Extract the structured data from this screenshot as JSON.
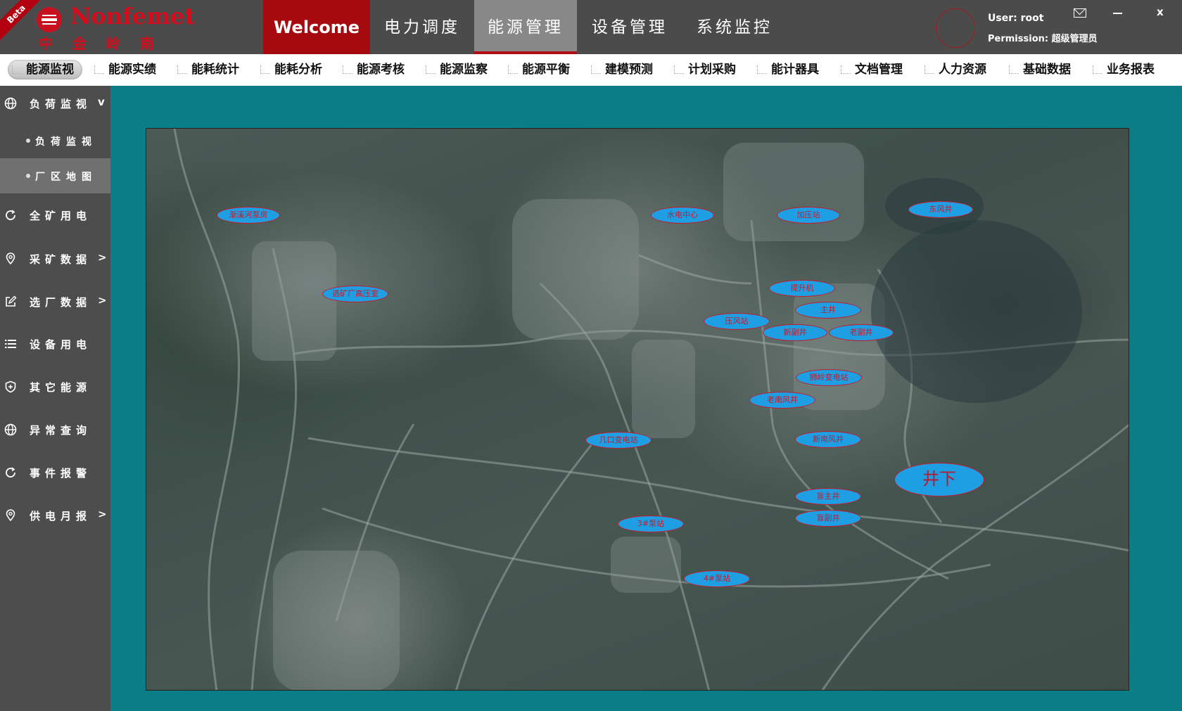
{
  "header": {
    "beta": "Beta",
    "logo_text": "Nonfemet",
    "logo_cn": "中金岭南",
    "nav": [
      "Welcome",
      "电力调度",
      "能源管理",
      "设备管理",
      "系统监控"
    ],
    "active_nav": "能源管理",
    "user_label": "User:",
    "user_value": "root",
    "permission_label": "Permission:",
    "permission_value": "超级管理员",
    "close_symbol": "x"
  },
  "toolbar": {
    "items": [
      "能源监视",
      "能源实绩",
      "能耗统计",
      "能耗分析",
      "能源考核",
      "能源监察",
      "能源平衡",
      "建模预测",
      "计划采购",
      "能计器具",
      "文档管理",
      "人力资源",
      "基础数据",
      "业务报表"
    ],
    "active": "能源监视"
  },
  "sidebar": {
    "items": [
      {
        "label": "负荷监视",
        "icon": "globe-icon",
        "chevron": "v"
      },
      {
        "label": "负荷监视",
        "sub": true
      },
      {
        "label": "厂区地图",
        "sub": true,
        "active": true
      },
      {
        "label": "全矿用电",
        "icon": "refresh-icon"
      },
      {
        "label": "采矿数据",
        "icon": "location-icon",
        "chevron": ">"
      },
      {
        "label": "选厂数据",
        "icon": "edit-icon",
        "chevron": ">"
      },
      {
        "label": "设备用电",
        "icon": "list-icon"
      },
      {
        "label": "其它能源",
        "icon": "shield-icon"
      },
      {
        "label": "异常查询",
        "icon": "globe-icon"
      },
      {
        "label": "事件报警",
        "icon": "refresh-icon"
      },
      {
        "label": "供电月报",
        "icon": "location-icon",
        "chevron": ">"
      }
    ]
  },
  "map": {
    "markers": [
      "渐溪河泵房",
      "水电中心",
      "加压站",
      "东风井",
      "选矿厂高压室",
      "提升机",
      "主井",
      "压风站",
      "新副井",
      "老副井",
      "狮岭变电站",
      "老南风井",
      "几口变电站",
      "新南风井",
      "井下",
      "盲主井",
      "盲副井",
      "3#泵站",
      "4#泵站"
    ]
  },
  "colors": {
    "topbar": "#4b4b4b",
    "welcome_bg": "#a60a0f",
    "active_nav_bg": "#888888",
    "content_bg": "#0a7d86",
    "marker_fill": "#1e9fe4",
    "marker_text": "#c41b2a"
  }
}
